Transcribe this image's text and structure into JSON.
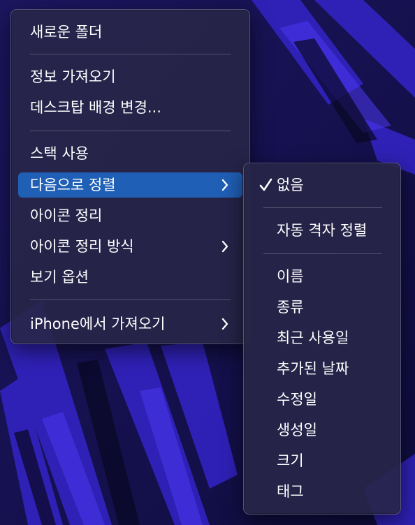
{
  "main_menu": {
    "items": [
      {
        "label": "새로운 폴더"
      },
      {
        "label": "정보 가져오기"
      },
      {
        "label": "데스크탑 배경 변경..."
      },
      {
        "label": "스택 사용"
      },
      {
        "label": "다음으로 정렬",
        "selected": true,
        "has_submenu": true
      },
      {
        "label": "아이콘 정리"
      },
      {
        "label": "아이콘 정리 방식",
        "has_submenu": true
      },
      {
        "label": "보기 옵션"
      },
      {
        "label": "iPhone에서 가져오기",
        "has_submenu": true
      }
    ]
  },
  "sort_submenu": {
    "items": [
      {
        "label": "없음",
        "checked": true
      },
      {
        "label": "자동 격자 정렬"
      },
      {
        "label": "이름"
      },
      {
        "label": "종류"
      },
      {
        "label": "최근 사용일"
      },
      {
        "label": "추가된 날짜"
      },
      {
        "label": "수정일"
      },
      {
        "label": "생성일"
      },
      {
        "label": "크기"
      },
      {
        "label": "태그"
      }
    ]
  },
  "icons": {
    "submenu_arrow": "chevron-right-icon",
    "checkmark": "checkmark-icon"
  },
  "colors": {
    "selection": "#1f5fb5",
    "menu_background": "#282648",
    "wallpaper_base": "#14104a",
    "wallpaper_accent": "#3b2ad6"
  }
}
